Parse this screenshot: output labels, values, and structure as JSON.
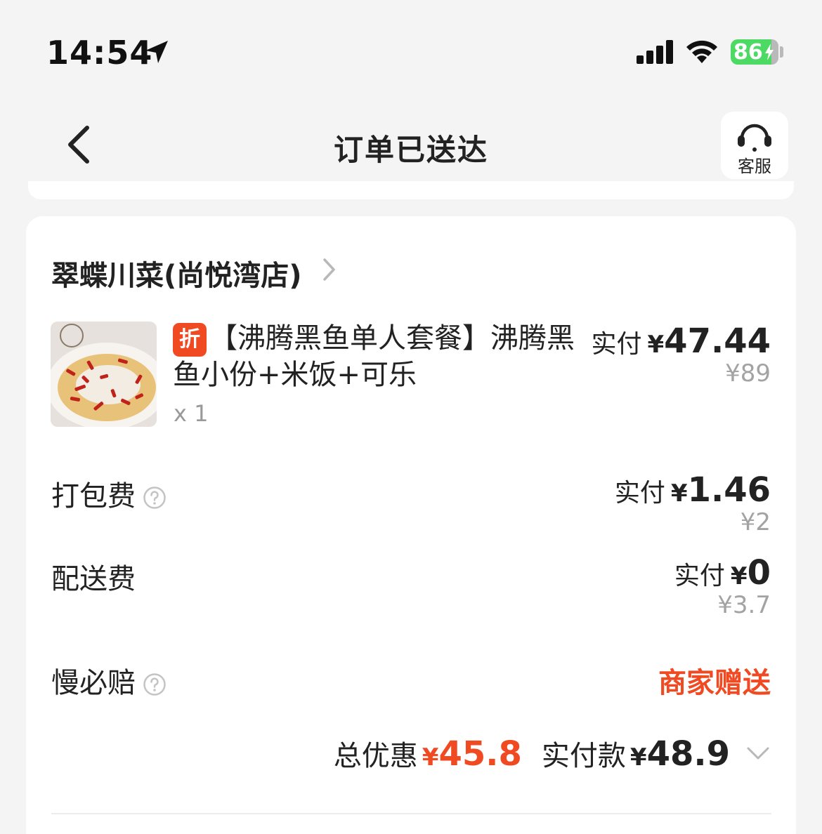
{
  "status_bar": {
    "time": "14:54",
    "battery": "86",
    "battery_color": "#4cd964",
    "icons": [
      "location-arrow-icon",
      "signal-icon",
      "wifi-icon",
      "battery-icon"
    ]
  },
  "nav": {
    "title": "订单已送达",
    "service_label": "客服",
    "icons": [
      "back-icon",
      "headset-icon"
    ]
  },
  "order": {
    "store_name": "翠蝶川菜(尚悦湾店)",
    "item": {
      "tag": "折",
      "name": "【沸腾黑鱼单人套餐】沸腾黑鱼小份+米饭+可乐",
      "qty": "x 1",
      "paid_label": "实付",
      "currency": "¥",
      "paid": "47.44",
      "original": "¥89"
    },
    "fees": [
      {
        "label": "打包费",
        "has_help": true,
        "paid_label": "实付",
        "currency": "¥",
        "paid": "1.46",
        "original": "¥2"
      },
      {
        "label": "配送费",
        "has_help": false,
        "paid_label": "实付",
        "currency": "¥",
        "paid": "0",
        "original": "¥3.7"
      }
    ],
    "slow_compensation": {
      "label": "慢必赔",
      "value": "商家赠送"
    },
    "summary": {
      "discount_label": "总优惠",
      "currency": "¥",
      "discount": "45.8",
      "paid_label": "实付款",
      "paid": "48.9"
    }
  },
  "colors": {
    "accent": "#f04a23",
    "muted": "#a3a3a3",
    "background": "#f4f4f4"
  }
}
